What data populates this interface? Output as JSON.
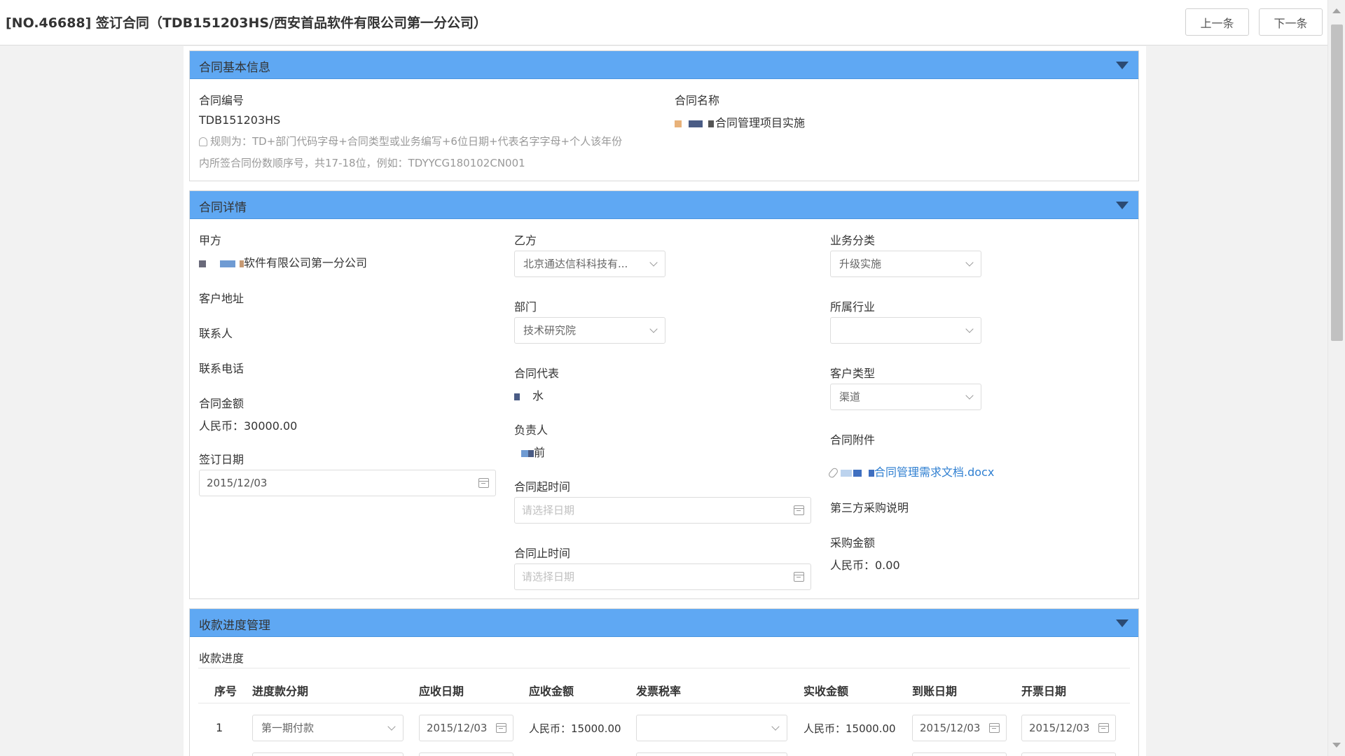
{
  "header": {
    "title": "[NO.46688] 签订合同（TDB151203HS/西安首品软件有限公司第一分公司）",
    "prev_label": "上一条",
    "next_label": "下一条"
  },
  "basic_info": {
    "section_title": "合同基本信息",
    "contract_no_label": "合同编号",
    "contract_no": "TDB151203HS",
    "rule_hint_line1": "规则为：TD+部门代码字母+合同类型或业务编写+6位日期+代表名字字母+个人该年份",
    "rule_hint_line2": "内所签合同份数顺序号，共17-18位，例如：TDYYCG180102CN001",
    "contract_name_label": "合同名称",
    "contract_name": "合同管理项目实施"
  },
  "details": {
    "section_title": "合同详情",
    "party_a_label": "甲方",
    "party_a": "软件有限公司第一分公司",
    "party_b_label": "乙方",
    "party_b": "北京通达信科科技有...",
    "biz_category_label": "业务分类",
    "biz_category": "升级实施",
    "address_label": "客户地址",
    "department_label": "部门",
    "department": "技术研究院",
    "industry_label": "所属行业",
    "industry": "",
    "contact_label": "联系人",
    "phone_label": "联系电话",
    "representative_label": "合同代表",
    "representative": "水",
    "customer_type_label": "客户类型",
    "customer_type": "渠道",
    "amount_label": "合同金额",
    "amount": "人民币：30000.00",
    "owner_label": "负责人",
    "owner": "前",
    "attachment_label": "合同附件",
    "attachment": "合同管理需求文档.docx",
    "sign_date_label": "签订日期",
    "sign_date": "2015/12/03",
    "start_date_label": "合同起时间",
    "start_date_placeholder": "请选择日期",
    "third_party_label": "第三方采购说明",
    "end_date_label": "合同止时间",
    "end_date_placeholder": "请选择日期",
    "purchase_amount_label": "采购金额",
    "purchase_amount": "人民币：0.00"
  },
  "payments": {
    "section_title": "收款进度管理",
    "sub_label": "收款进度",
    "columns": [
      "序号",
      "进度款分期",
      "应收日期",
      "应收金额",
      "发票税率",
      "实收金额",
      "到账日期",
      "开票日期"
    ],
    "rows": [
      {
        "index": "1",
        "stage": "第一期付款",
        "due_date": "2015/12/03",
        "due_amount": "人民币：15000.00",
        "tax_rate": "",
        "received_amount": "人民币：15000.00",
        "arrival_date": "2015/12/03",
        "invoice_date": "2015/12/03"
      }
    ]
  },
  "colors": {
    "section_header": "#5fa8f3",
    "link": "#2f7fd1"
  }
}
